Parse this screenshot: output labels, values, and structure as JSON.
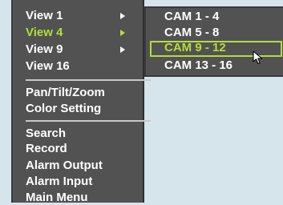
{
  "main_menu": {
    "items": [
      {
        "label": "View 1",
        "has_submenu": true,
        "active": false
      },
      {
        "label": "View 4",
        "has_submenu": true,
        "active": true
      },
      {
        "label": "View 9",
        "has_submenu": true,
        "active": false
      },
      {
        "label": "View 16",
        "has_submenu": false,
        "active": false
      },
      {
        "label": "Pan/Tilt/Zoom",
        "has_submenu": false,
        "active": false
      },
      {
        "label": "Color Setting",
        "has_submenu": false,
        "active": false
      },
      {
        "label": "Search",
        "has_submenu": false,
        "active": false
      },
      {
        "label": "Record",
        "has_submenu": false,
        "active": false
      },
      {
        "label": "Alarm Output",
        "has_submenu": false,
        "active": false
      },
      {
        "label": "Alarm Input",
        "has_submenu": false,
        "active": false
      },
      {
        "label": "Main Menu",
        "has_submenu": false,
        "active": false
      }
    ]
  },
  "submenu": {
    "items": [
      {
        "label": "CAM 1 - 4",
        "selected": false
      },
      {
        "label": "CAM 5 - 8",
        "selected": false
      },
      {
        "label": "CAM 9 - 12",
        "selected": true
      },
      {
        "label": "CAM 13 - 16",
        "selected": false
      }
    ]
  },
  "colors": {
    "background": "#d6e5eb",
    "menu_bg": "#525252",
    "text": "#ffffff",
    "highlight": "#b4dc3c"
  },
  "icons": {
    "submenu_arrow": "right-triangle-icon",
    "cursor": "mouse-pointer-icon"
  }
}
